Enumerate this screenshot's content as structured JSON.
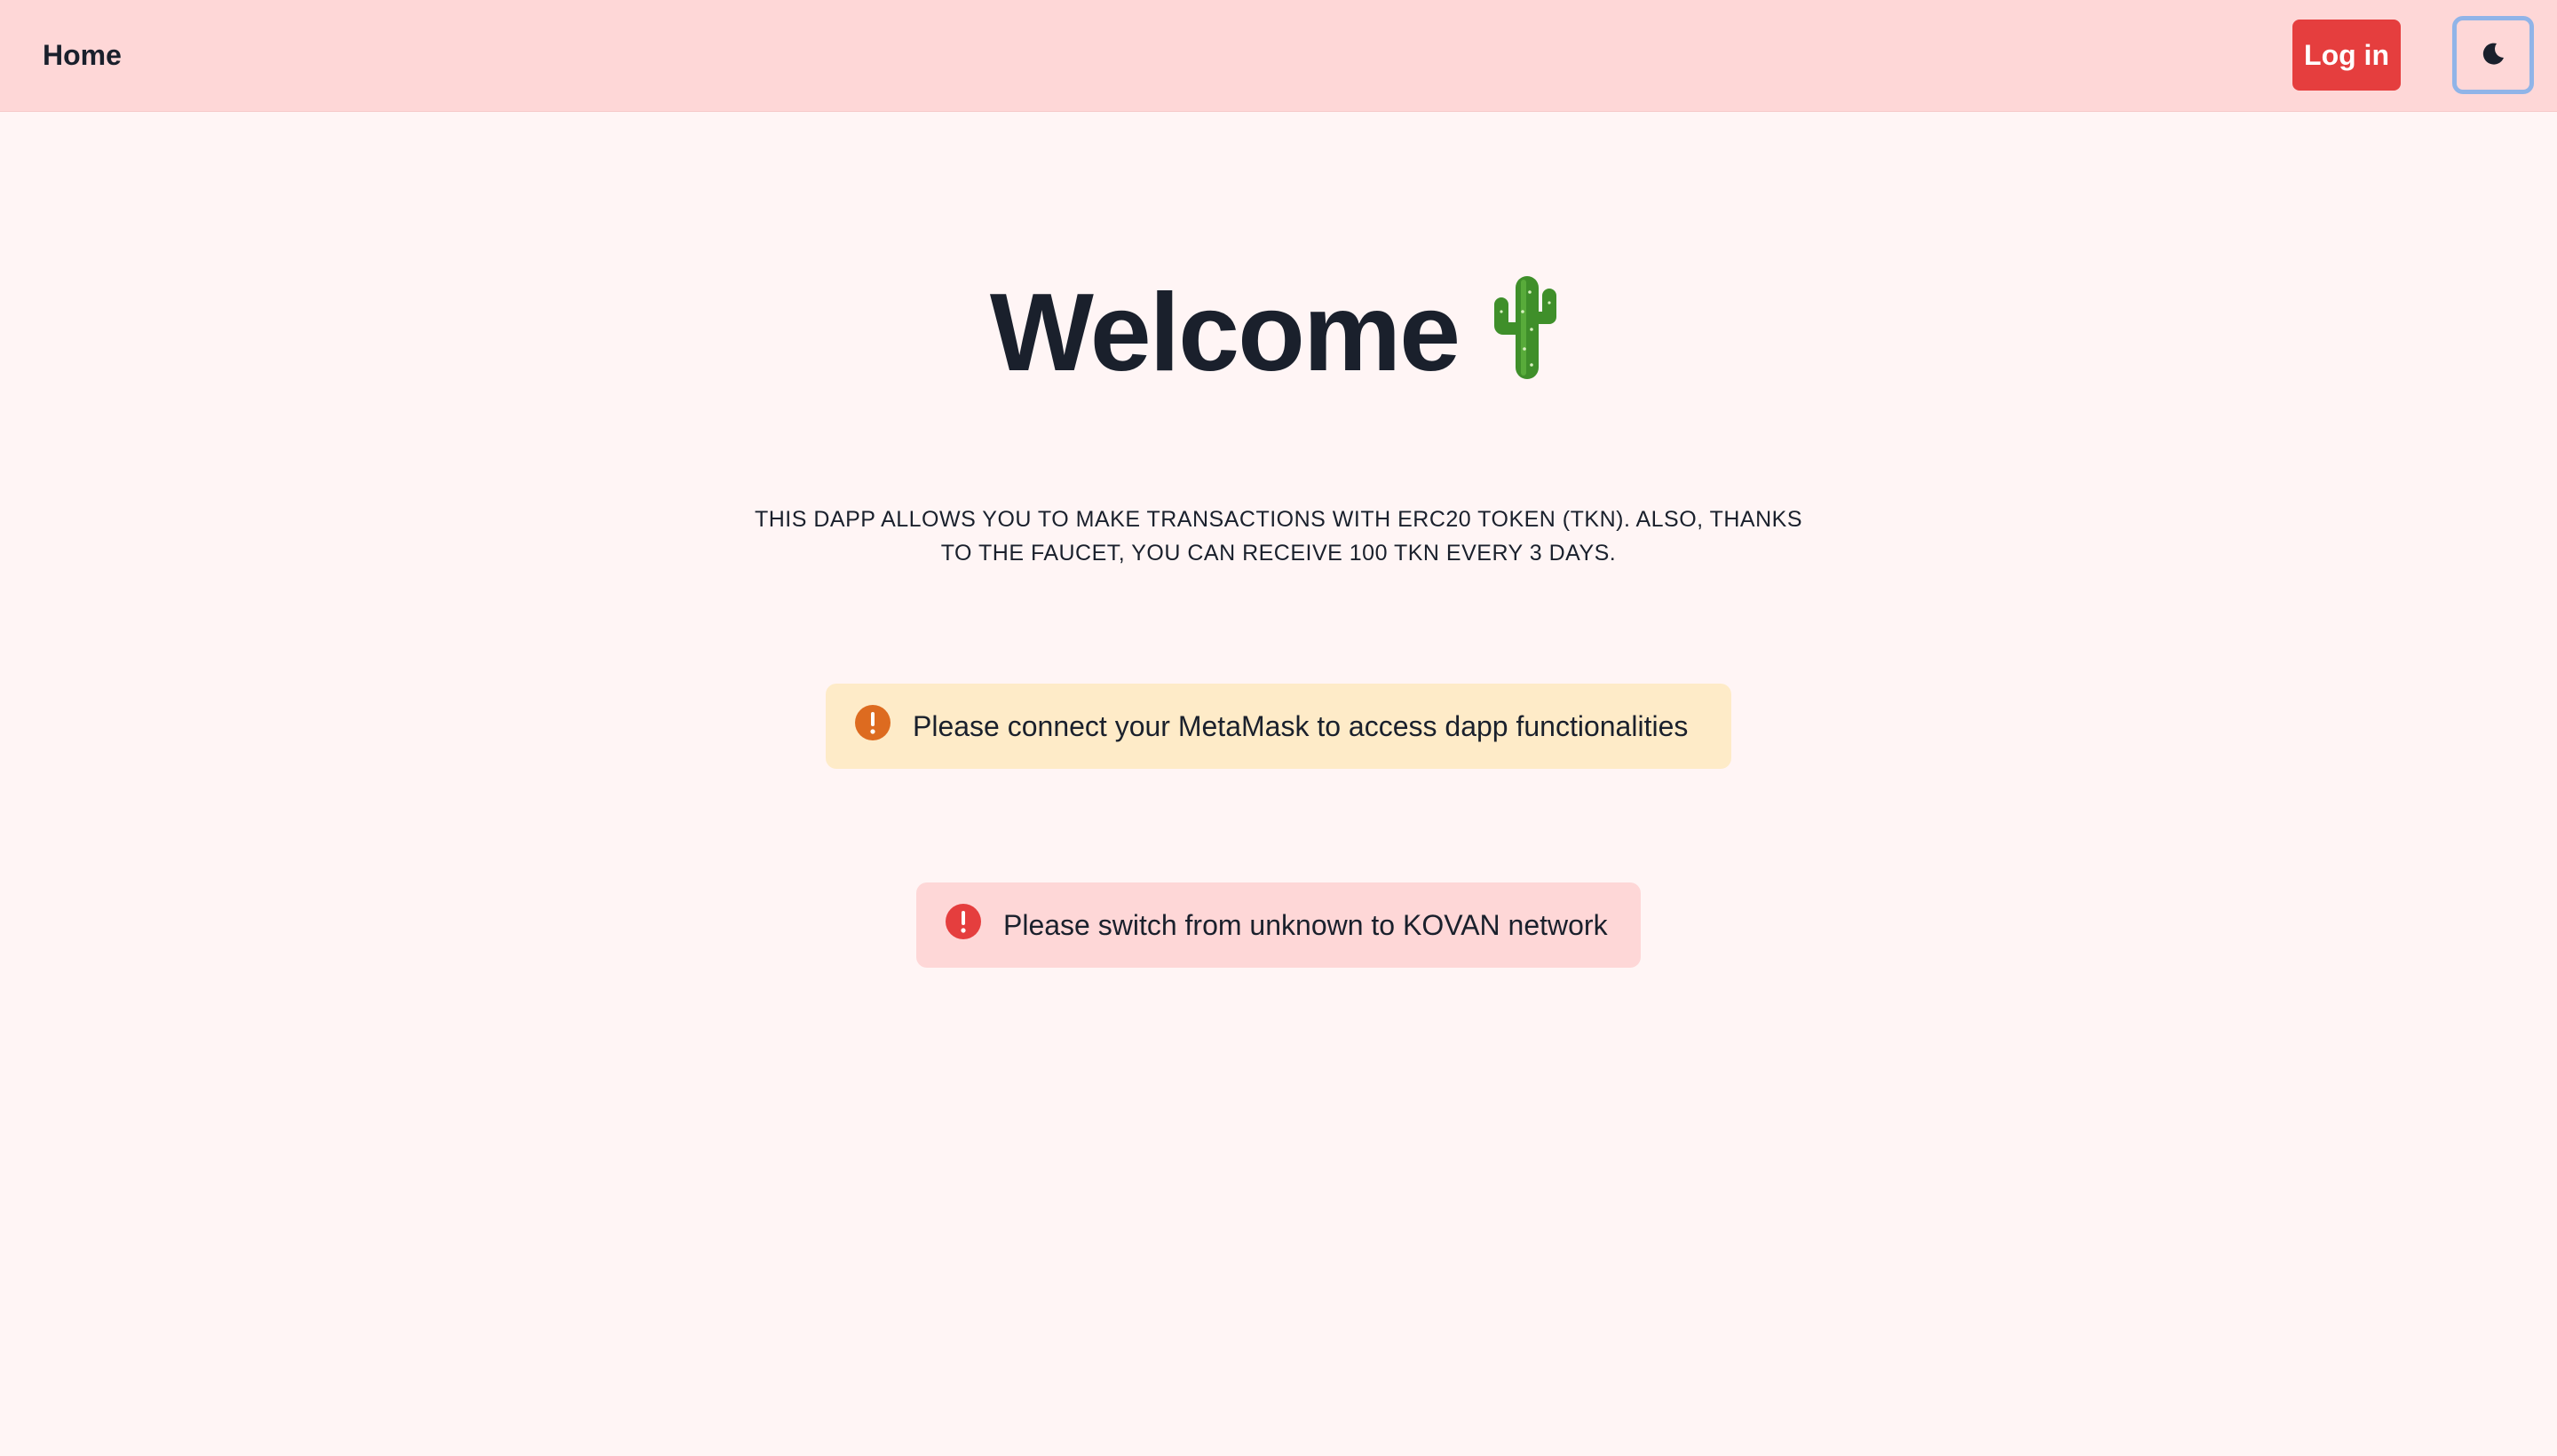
{
  "nav": {
    "home_label": "Home",
    "login_label": "Log in",
    "theme_icon": "moon-icon"
  },
  "hero": {
    "title": "Welcome",
    "emoji_icon": "cactus-icon",
    "description": "THIS DAPP ALLOWS YOU TO MAKE TRANSACTIONS WITH ERC20 TOKEN (TKN). ALSO, THANKS TO THE FAUCET, YOU CAN RECEIVE 100 TKN EVERY 3 DAYS."
  },
  "alerts": [
    {
      "status": "warning",
      "icon": "warning-icon",
      "message": "Please connect your MetaMask to access dapp functionalities",
      "color": "#dd6b20"
    },
    {
      "status": "error",
      "icon": "error-icon",
      "message": "Please switch from unknown to KOVAN network",
      "color": "#e53e3e"
    }
  ],
  "colors": {
    "background": "#fff5f5",
    "navbar": "#fed7d7",
    "login_button": "#e53e3e",
    "warning_bg": "#feebc8",
    "error_bg": "#fed7d7"
  }
}
